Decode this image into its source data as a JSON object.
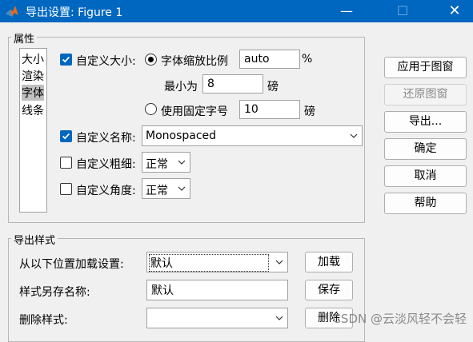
{
  "window": {
    "title": "导出设置: Figure 1",
    "controls": {
      "minimize": "—",
      "maximize": "☐",
      "close": "✕"
    }
  },
  "properties_group": {
    "title": "属性",
    "categories": [
      "大小",
      "渲染",
      "字体",
      "线条"
    ],
    "selected_category": "字体",
    "custom_size": {
      "label": "自定义大小:",
      "checked": true
    },
    "font_scale": {
      "label": "字体缩放比例",
      "value": "auto",
      "unit": "%",
      "selected": true
    },
    "min_size": {
      "label": "最小为",
      "value": "8",
      "unit": "磅"
    },
    "fixed_size": {
      "label": "使用固定字号",
      "value": "10",
      "unit": "磅",
      "selected": false
    },
    "custom_name": {
      "label": "自定义名称:",
      "checked": true,
      "value": "Monospaced"
    },
    "custom_weight": {
      "label": "自定义粗细:",
      "checked": false,
      "value": "正常"
    },
    "custom_angle": {
      "label": "自定义角度:",
      "checked": false,
      "value": "正常"
    }
  },
  "side_buttons": {
    "apply": "应用于图窗",
    "restore": "还原图窗",
    "export": "导出...",
    "ok": "确定",
    "cancel": "取消",
    "help": "帮助"
  },
  "styles_group": {
    "title": "导出样式",
    "load_label": "从以下位置加载设置:",
    "load_value": "默认",
    "load_button": "加载",
    "save_label": "样式另存名称:",
    "save_value": "默认",
    "save_button": "保存",
    "delete_label": "删除样式:",
    "delete_value": "",
    "delete_button": "删除"
  },
  "watermark": "CSDN @云淡风轻不会轻",
  "colors": {
    "titlebar": "#0067c0",
    "accent": "#0067c0",
    "window_bg": "#f0f0f0"
  }
}
